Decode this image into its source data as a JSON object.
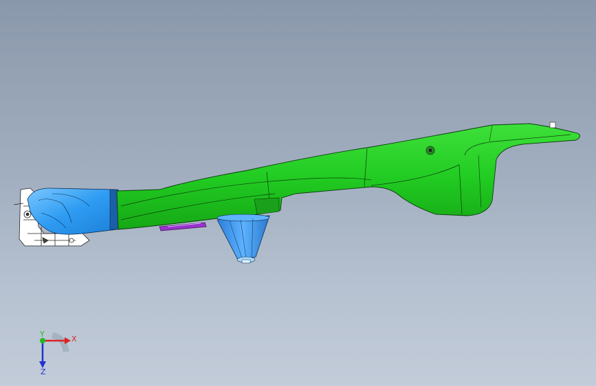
{
  "viewport": {
    "background_top": "#8a98ab",
    "background_bottom": "#c3ccd9"
  },
  "model": {
    "parts": [
      {
        "name": "main-bracket-body",
        "color": "#22cc22"
      },
      {
        "name": "front-end-cap",
        "color": "#33aaff"
      },
      {
        "name": "conical-boss",
        "color": "#3399ee"
      },
      {
        "name": "purple-clip",
        "color": "#9933cc"
      },
      {
        "name": "wireframe-fixture",
        "color": "#ffffff"
      }
    ]
  },
  "triad": {
    "x_label": "X",
    "y_label": "Y",
    "z_label": "Z",
    "x_color": "#dd2222",
    "y_color": "#22bb22",
    "z_color": "#2233cc"
  }
}
